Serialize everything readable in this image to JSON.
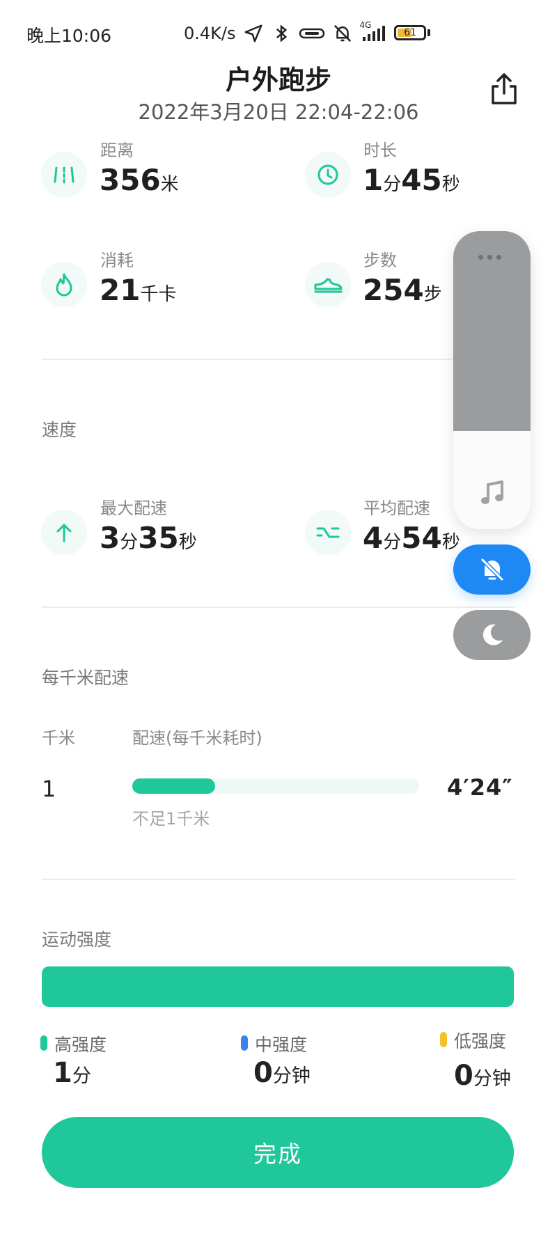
{
  "status_bar": {
    "time": "晚上10:06",
    "net_speed": "0.4K/s",
    "signal_label": "4G",
    "battery": "61",
    "battery_percent": 61,
    "icons": [
      "location-icon",
      "bluetooth-icon",
      "link-icon",
      "mute-icon",
      "signal-icon",
      "battery-icon"
    ]
  },
  "header": {
    "title": "户外跑步",
    "subtitle": "2022年3月20日 22:04-22:06",
    "share_icon": "share-icon"
  },
  "stats": {
    "distance": {
      "label": "距离",
      "value": "356",
      "unit": "米",
      "icon": "distance-icon"
    },
    "duration": {
      "label": "时长",
      "value_min": "1",
      "unit_min": "分",
      "value_sec": "45",
      "unit_sec": "秒",
      "icon": "clock-icon"
    },
    "calories": {
      "label": "消耗",
      "value": "21",
      "unit": "千卡",
      "icon": "flame-icon"
    },
    "steps": {
      "label": "步数",
      "value": "254",
      "unit": "步",
      "icon": "shoe-icon"
    }
  },
  "speed": {
    "section_title": "速度",
    "max_pace": {
      "label": "最大配速",
      "min": "3",
      "min_unit": "分",
      "sec": "35",
      "sec_unit": "秒",
      "icon": "arrow-up-icon"
    },
    "avg_pace": {
      "label": "平均配速",
      "min": "4",
      "min_unit": "分",
      "sec": "54",
      "sec_unit": "秒",
      "icon": "wave-icon"
    }
  },
  "per_km": {
    "section_title": "每千米配速",
    "col_km": "千米",
    "col_pace": "配速(每千米耗时)",
    "rows": [
      {
        "km": "1",
        "pace": "4′24″",
        "fill_fraction": 0.29,
        "note": "不足1千米"
      }
    ]
  },
  "intensity": {
    "section_title": "运动强度",
    "high": {
      "label": "高强度",
      "value": "1",
      "unit": "分",
      "color": "#1fc79a"
    },
    "medium": {
      "label": "中强度",
      "value": "0",
      "unit": "分钟",
      "color": "#3b82f0"
    },
    "low": {
      "label": "低强度",
      "value": "0",
      "unit": "分钟",
      "color": "#f2c12e"
    }
  },
  "floating_panel": {
    "volume_fraction": 0.67,
    "icons": [
      "more-icon",
      "music-icon",
      "bell-off-icon",
      "moon-icon"
    ],
    "colors": {
      "slider": "#9a9c9e",
      "mute_active": "#1e88f4"
    }
  },
  "done_button": {
    "label": "完成"
  },
  "colors": {
    "accent": "#1fc79a"
  }
}
